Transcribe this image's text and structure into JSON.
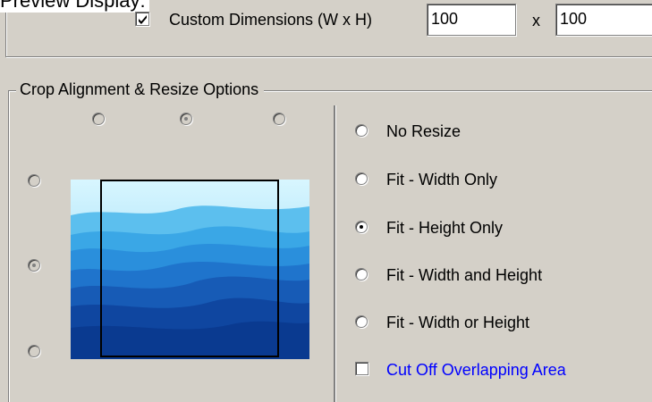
{
  "header": {
    "section_label": "Preview Display:"
  },
  "dimensions": {
    "custom_checked": true,
    "custom_label": "Custom Dimensions (W x H)",
    "width_value": "100",
    "separator": "x",
    "height_value": "100"
  },
  "crop_group": {
    "title": "Crop Alignment & Resize Options",
    "alignment": {
      "top": [
        "left",
        "center",
        "right"
      ],
      "top_selected": "center",
      "side": [
        "top",
        "middle",
        "bottom"
      ],
      "side_selected": "middle"
    },
    "resize_options": [
      {
        "label": "No Resize",
        "selected": false
      },
      {
        "label": "Fit - Width Only",
        "selected": false
      },
      {
        "label": "Fit - Height Only",
        "selected": true
      },
      {
        "label": "Fit - Width and Height",
        "selected": false
      },
      {
        "label": "Fit - Width or Height",
        "selected": false
      }
    ],
    "cut_off": {
      "label": "Cut Off Overlapping Area",
      "checked": false,
      "color": "#0000ff"
    }
  },
  "colors": {
    "dialog_bg": "#d4d0c8",
    "sky": "#bfeeff",
    "mountain_dark": "#0a3a9a"
  }
}
